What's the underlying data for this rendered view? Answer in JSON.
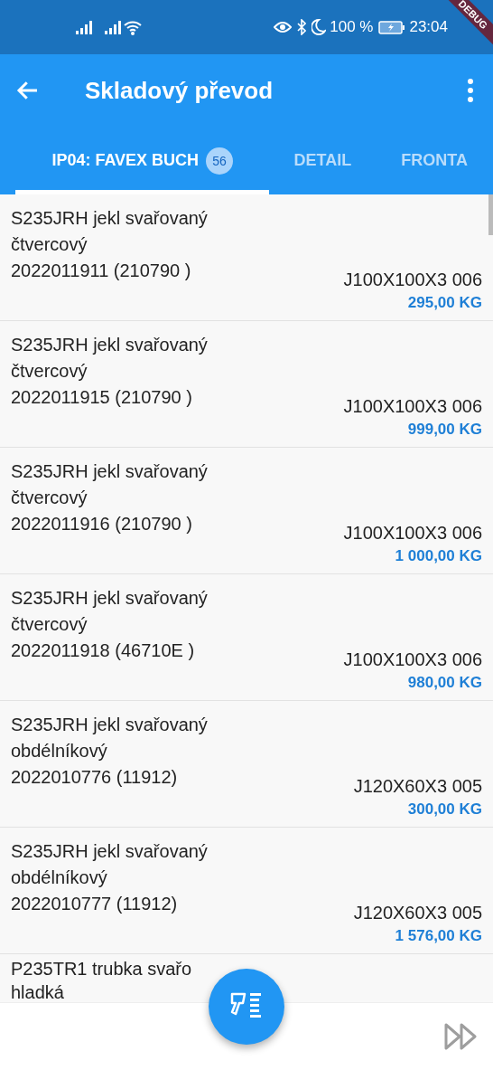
{
  "status_bar": {
    "battery": "100 %",
    "time": "23:04"
  },
  "debug_banner": "DEBUG",
  "app_bar": {
    "title": "Skladový převod"
  },
  "tabs": [
    {
      "label": "IP04: FAVEX BUCH",
      "count": "56",
      "selected": true
    },
    {
      "label": "DETAIL",
      "selected": false
    },
    {
      "label": "FRONTA",
      "selected": false
    }
  ],
  "items": [
    {
      "name": "S235JRH jekl svařovaný čtvercový",
      "batch": "2022011911 (210790 )",
      "dimension": "J100X100X3 006",
      "weight": "295,00 KG"
    },
    {
      "name": "S235JRH jekl svařovaný čtvercový",
      "batch": "2022011915 (210790 )",
      "dimension": "J100X100X3 006",
      "weight": "999,00 KG"
    },
    {
      "name": "S235JRH jekl svařovaný čtvercový",
      "batch": "2022011916 (210790 )",
      "dimension": "J100X100X3 006",
      "weight": "1 000,00 KG"
    },
    {
      "name": "S235JRH jekl svařovaný čtvercový",
      "batch": "2022011918 (46710E )",
      "dimension": "J100X100X3 006",
      "weight": "980,00 KG"
    },
    {
      "name": "S235JRH jekl svařovaný obdélníkový",
      "batch": "2022010776 (11912)",
      "dimension": "J120X60X3 005",
      "weight": "300,00 KG"
    },
    {
      "name": "S235JRH jekl svařovaný obdélníkový",
      "batch": "2022010777 (11912)",
      "dimension": "J120X60X3 005",
      "weight": "1 576,00 KG"
    },
    {
      "name": "P235TR1 trubka svařo",
      "name_line_2": "hladká"
    }
  ]
}
